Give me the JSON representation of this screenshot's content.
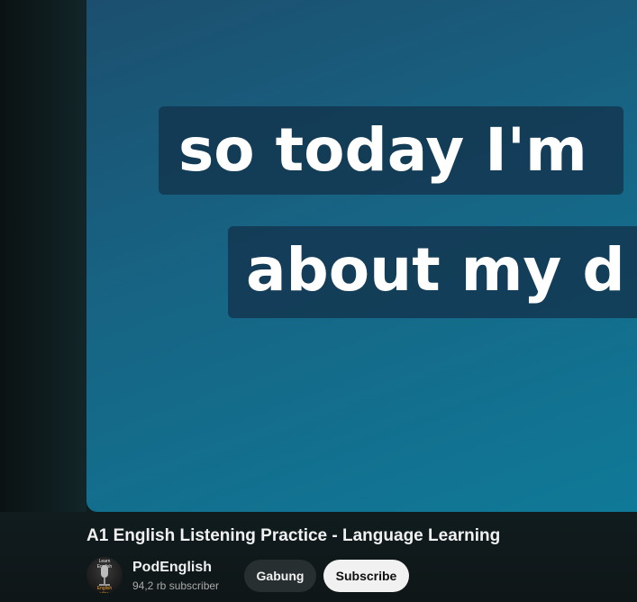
{
  "video": {
    "captions": [
      "so today I'm",
      "about my d"
    ]
  },
  "title": "A1 English Listening Practice - Language Learning",
  "channel": {
    "name": "PodEnglish",
    "subscribers": "94,2 rb subscriber",
    "avatar_text_top": "Learn English",
    "avatar_text_bottom": "English podcast"
  },
  "actions": {
    "join_label": "Gabung",
    "subscribe_label": "Subscribe"
  },
  "colors": {
    "player_accent": "#176484",
    "subscribe_bg": "#f1f1f1",
    "join_bg": "#272f30"
  }
}
